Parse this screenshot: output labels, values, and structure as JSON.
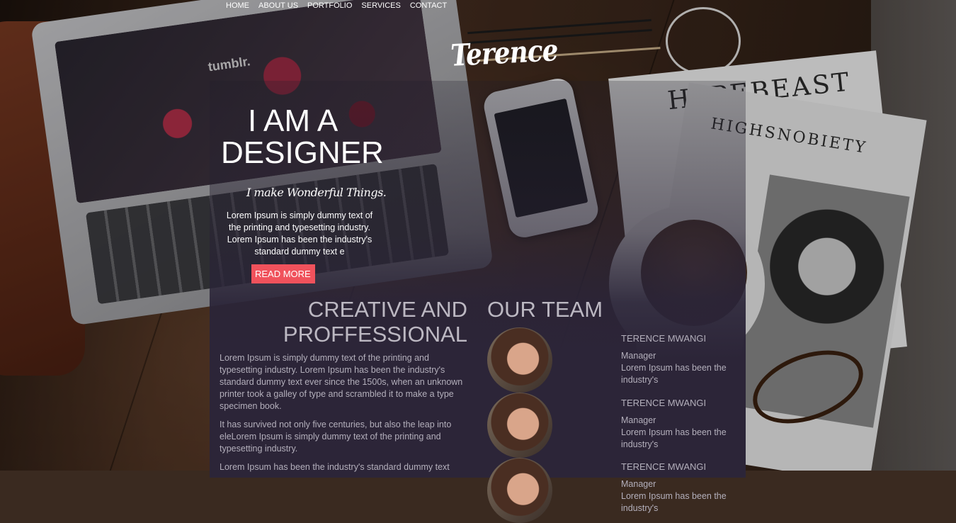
{
  "nav": {
    "items": [
      "HOME",
      "ABOUT US",
      "PORTFOLIO",
      "SERVICES",
      "CONTACT"
    ]
  },
  "brand": "Terence",
  "hero": {
    "title_line1": "I AM A",
    "title_line2": "DESIGNER",
    "tagline": "I make Wonderful Things.",
    "text": "Lorem Ipsum is simply dummy text of the printing and typesetting industry. Lorem Ipsum has been the industry's standard dummy text e",
    "button": "READ MORE"
  },
  "creative": {
    "heading_line1": "CREATIVE AND",
    "heading_line2": "PROFFESSIONAL",
    "paragraphs": [
      "Lorem Ipsum is simply dummy text of the printing and typesetting industry. Lorem Ipsum has been the industry's standard dummy text ever since the 1500s, when an unknown printer took a galley of type and scrambled it to make a type specimen book.",
      "It has survived not only five centuries, but also the leap into eleLorem Ipsum is simply dummy text of the printing and typesetting industry.",
      "Lorem Ipsum has been the industry's standard dummy text"
    ]
  },
  "team": {
    "heading": "OUR TEAM",
    "members": [
      {
        "name": "TERENCE MWANGI",
        "role": "Manager",
        "bio": "Lorem Ipsum has been the industry's"
      },
      {
        "name": "TERENCE MWANGI",
        "role": "Manager",
        "bio": "Lorem Ipsum has been the industry's"
      },
      {
        "name": "TERENCE MWANGI",
        "role": "Manager",
        "bio": "Lorem Ipsum has been the industry's"
      }
    ]
  },
  "background": {
    "magazine_title_1": "HYPEBEAST",
    "magazine_title_2": "HIGHSNOBIETY",
    "screen_logo": "tumblr."
  },
  "colors": {
    "accent": "#f0525c",
    "panel": "#2c2538",
    "heading": "#bcb8c2",
    "text": "#b3afbb"
  }
}
